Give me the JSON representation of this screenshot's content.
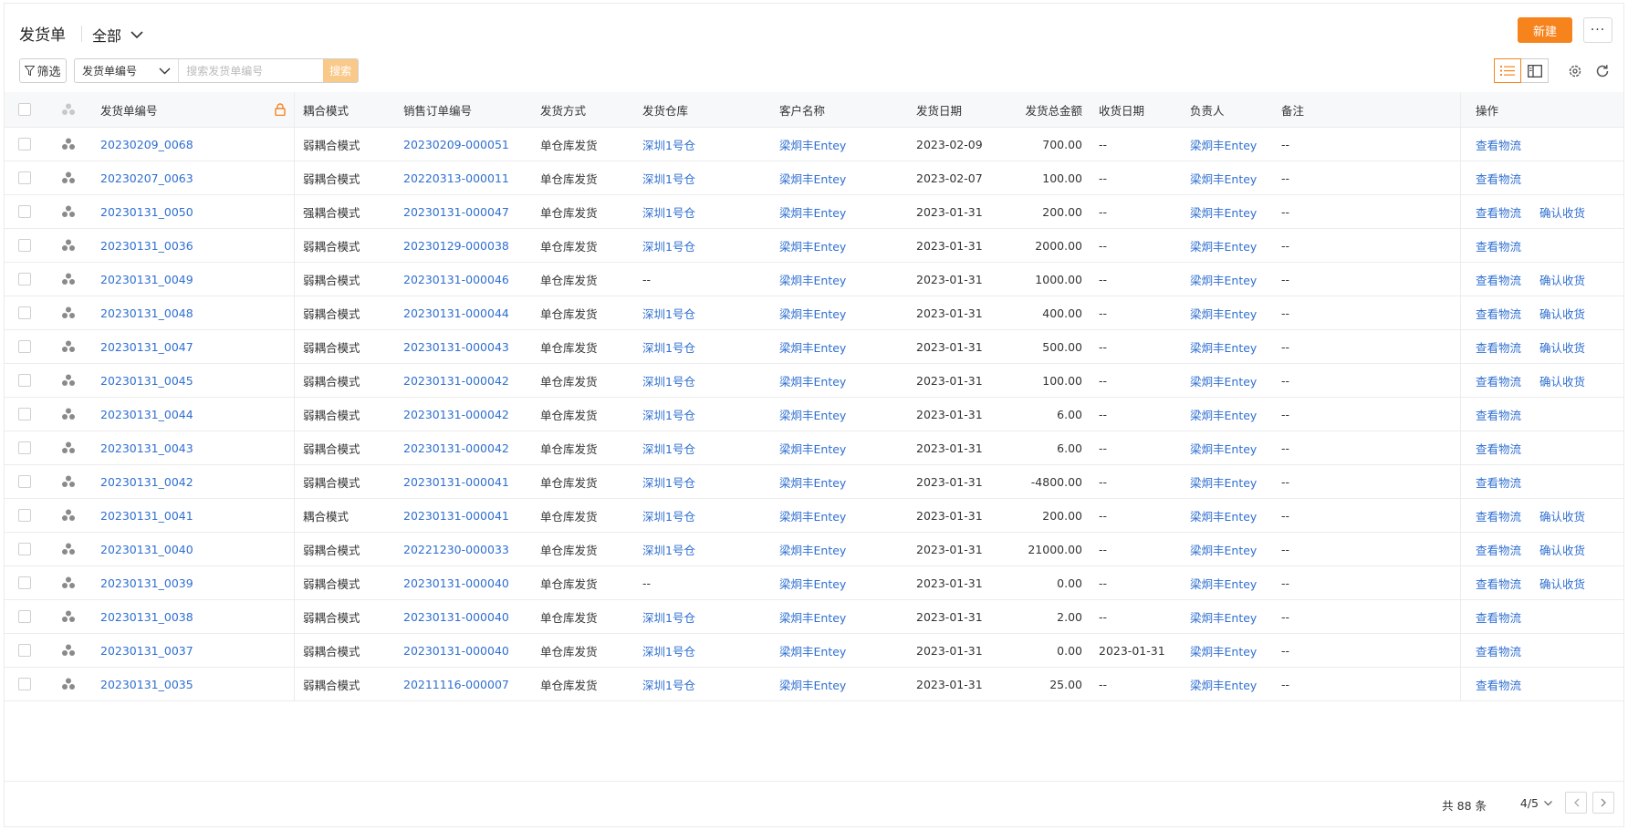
{
  "header": {
    "title": "发货单",
    "view": "全部",
    "new_label": "新建",
    "more_label": "···"
  },
  "toolbar": {
    "filter_label": "筛选",
    "search_field": "发货单编号",
    "search_placeholder": "搜索发货单编号",
    "search_button": "搜索"
  },
  "table": {
    "columns": [
      "发货单编号",
      "耦合模式",
      "销售订单编号",
      "发货方式",
      "发货仓库",
      "客户名称",
      "发货日期",
      "发货总金额",
      "收货日期",
      "负责人",
      "备注",
      "操作"
    ],
    "actions": {
      "view_logistics": "查看物流",
      "confirm_receipt": "确认收货"
    },
    "rows": [
      {
        "no": "20230209_0068",
        "mode": "弱耦合模式",
        "so": "20230209-000051",
        "ship": "单仓库发货",
        "wh": "深圳1号仓",
        "cust": "梁炯丰Entey",
        "date": "2023-02-09",
        "amount": "700.00",
        "rdate": "--",
        "owner": "梁炯丰Entey",
        "note": "--",
        "confirm": false
      },
      {
        "no": "20230207_0063",
        "mode": "弱耦合模式",
        "so": "20220313-000011",
        "ship": "单仓库发货",
        "wh": "深圳1号仓",
        "cust": "梁炯丰Entey",
        "date": "2023-02-07",
        "amount": "100.00",
        "rdate": "--",
        "owner": "梁炯丰Entey",
        "note": "--",
        "confirm": false
      },
      {
        "no": "20230131_0050",
        "mode": "强耦合模式",
        "so": "20230131-000047",
        "ship": "单仓库发货",
        "wh": "深圳1号仓",
        "cust": "梁炯丰Entey",
        "date": "2023-01-31",
        "amount": "200.00",
        "rdate": "--",
        "owner": "梁炯丰Entey",
        "note": "--",
        "confirm": true
      },
      {
        "no": "20230131_0036",
        "mode": "弱耦合模式",
        "so": "20230129-000038",
        "ship": "单仓库发货",
        "wh": "深圳1号仓",
        "cust": "梁炯丰Entey",
        "date": "2023-01-31",
        "amount": "2000.00",
        "rdate": "--",
        "owner": "梁炯丰Entey",
        "note": "--",
        "confirm": false
      },
      {
        "no": "20230131_0049",
        "mode": "弱耦合模式",
        "so": "20230131-000046",
        "ship": "单仓库发货",
        "wh": "--",
        "cust": "梁炯丰Entey",
        "date": "2023-01-31",
        "amount": "1000.00",
        "rdate": "--",
        "owner": "梁炯丰Entey",
        "note": "--",
        "confirm": true
      },
      {
        "no": "20230131_0048",
        "mode": "弱耦合模式",
        "so": "20230131-000044",
        "ship": "单仓库发货",
        "wh": "深圳1号仓",
        "cust": "梁炯丰Entey",
        "date": "2023-01-31",
        "amount": "400.00",
        "rdate": "--",
        "owner": "梁炯丰Entey",
        "note": "--",
        "confirm": true
      },
      {
        "no": "20230131_0047",
        "mode": "弱耦合模式",
        "so": "20230131-000043",
        "ship": "单仓库发货",
        "wh": "深圳1号仓",
        "cust": "梁炯丰Entey",
        "date": "2023-01-31",
        "amount": "500.00",
        "rdate": "--",
        "owner": "梁炯丰Entey",
        "note": "--",
        "confirm": true
      },
      {
        "no": "20230131_0045",
        "mode": "弱耦合模式",
        "so": "20230131-000042",
        "ship": "单仓库发货",
        "wh": "深圳1号仓",
        "cust": "梁炯丰Entey",
        "date": "2023-01-31",
        "amount": "100.00",
        "rdate": "--",
        "owner": "梁炯丰Entey",
        "note": "--",
        "confirm": true
      },
      {
        "no": "20230131_0044",
        "mode": "弱耦合模式",
        "so": "20230131-000042",
        "ship": "单仓库发货",
        "wh": "深圳1号仓",
        "cust": "梁炯丰Entey",
        "date": "2023-01-31",
        "amount": "6.00",
        "rdate": "--",
        "owner": "梁炯丰Entey",
        "note": "--",
        "confirm": false
      },
      {
        "no": "20230131_0043",
        "mode": "弱耦合模式",
        "so": "20230131-000042",
        "ship": "单仓库发货",
        "wh": "深圳1号仓",
        "cust": "梁炯丰Entey",
        "date": "2023-01-31",
        "amount": "6.00",
        "rdate": "--",
        "owner": "梁炯丰Entey",
        "note": "--",
        "confirm": false
      },
      {
        "no": "20230131_0042",
        "mode": "弱耦合模式",
        "so": "20230131-000041",
        "ship": "单仓库发货",
        "wh": "深圳1号仓",
        "cust": "梁炯丰Entey",
        "date": "2023-01-31",
        "amount": "-4800.00",
        "rdate": "--",
        "owner": "梁炯丰Entey",
        "note": "--",
        "confirm": false
      },
      {
        "no": "20230131_0041",
        "mode": "耦合模式",
        "so": "20230131-000041",
        "ship": "单仓库发货",
        "wh": "深圳1号仓",
        "cust": "梁炯丰Entey",
        "date": "2023-01-31",
        "amount": "200.00",
        "rdate": "--",
        "owner": "梁炯丰Entey",
        "note": "--",
        "confirm": true
      },
      {
        "no": "20230131_0040",
        "mode": "弱耦合模式",
        "so": "20221230-000033",
        "ship": "单仓库发货",
        "wh": "深圳1号仓",
        "cust": "梁炯丰Entey",
        "date": "2023-01-31",
        "amount": "21000.00",
        "rdate": "--",
        "owner": "梁炯丰Entey",
        "note": "--",
        "confirm": true
      },
      {
        "no": "20230131_0039",
        "mode": "弱耦合模式",
        "so": "20230131-000040",
        "ship": "单仓库发货",
        "wh": "--",
        "cust": "梁炯丰Entey",
        "date": "2023-01-31",
        "amount": "0.00",
        "rdate": "--",
        "owner": "梁炯丰Entey",
        "note": "--",
        "confirm": true
      },
      {
        "no": "20230131_0038",
        "mode": "弱耦合模式",
        "so": "20230131-000040",
        "ship": "单仓库发货",
        "wh": "深圳1号仓",
        "cust": "梁炯丰Entey",
        "date": "2023-01-31",
        "amount": "2.00",
        "rdate": "--",
        "owner": "梁炯丰Entey",
        "note": "--",
        "confirm": false
      },
      {
        "no": "20230131_0037",
        "mode": "弱耦合模式",
        "so": "20230131-000040",
        "ship": "单仓库发货",
        "wh": "深圳1号仓",
        "cust": "梁炯丰Entey",
        "date": "2023-01-31",
        "amount": "0.00",
        "rdate": "2023-01-31",
        "owner": "梁炯丰Entey",
        "note": "--",
        "confirm": false
      },
      {
        "no": "20230131_0035",
        "mode": "弱耦合模式",
        "so": "20211116-000007",
        "ship": "单仓库发货",
        "wh": "深圳1号仓",
        "cust": "梁炯丰Entey",
        "date": "2023-01-31",
        "amount": "25.00",
        "rdate": "--",
        "owner": "梁炯丰Entey",
        "note": "--",
        "confirm": false
      }
    ]
  },
  "footer": {
    "total": "共 88 条",
    "page": "4/5"
  },
  "colors": {
    "accent": "#f7831c",
    "link": "#2f6fd0"
  },
  "icons": [
    "chevron-down-icon",
    "filter-icon",
    "list-view-icon",
    "card-view-icon",
    "settings-icon",
    "refresh-icon",
    "lock-icon",
    "group-icon",
    "chevron-left-icon",
    "chevron-right-icon"
  ]
}
